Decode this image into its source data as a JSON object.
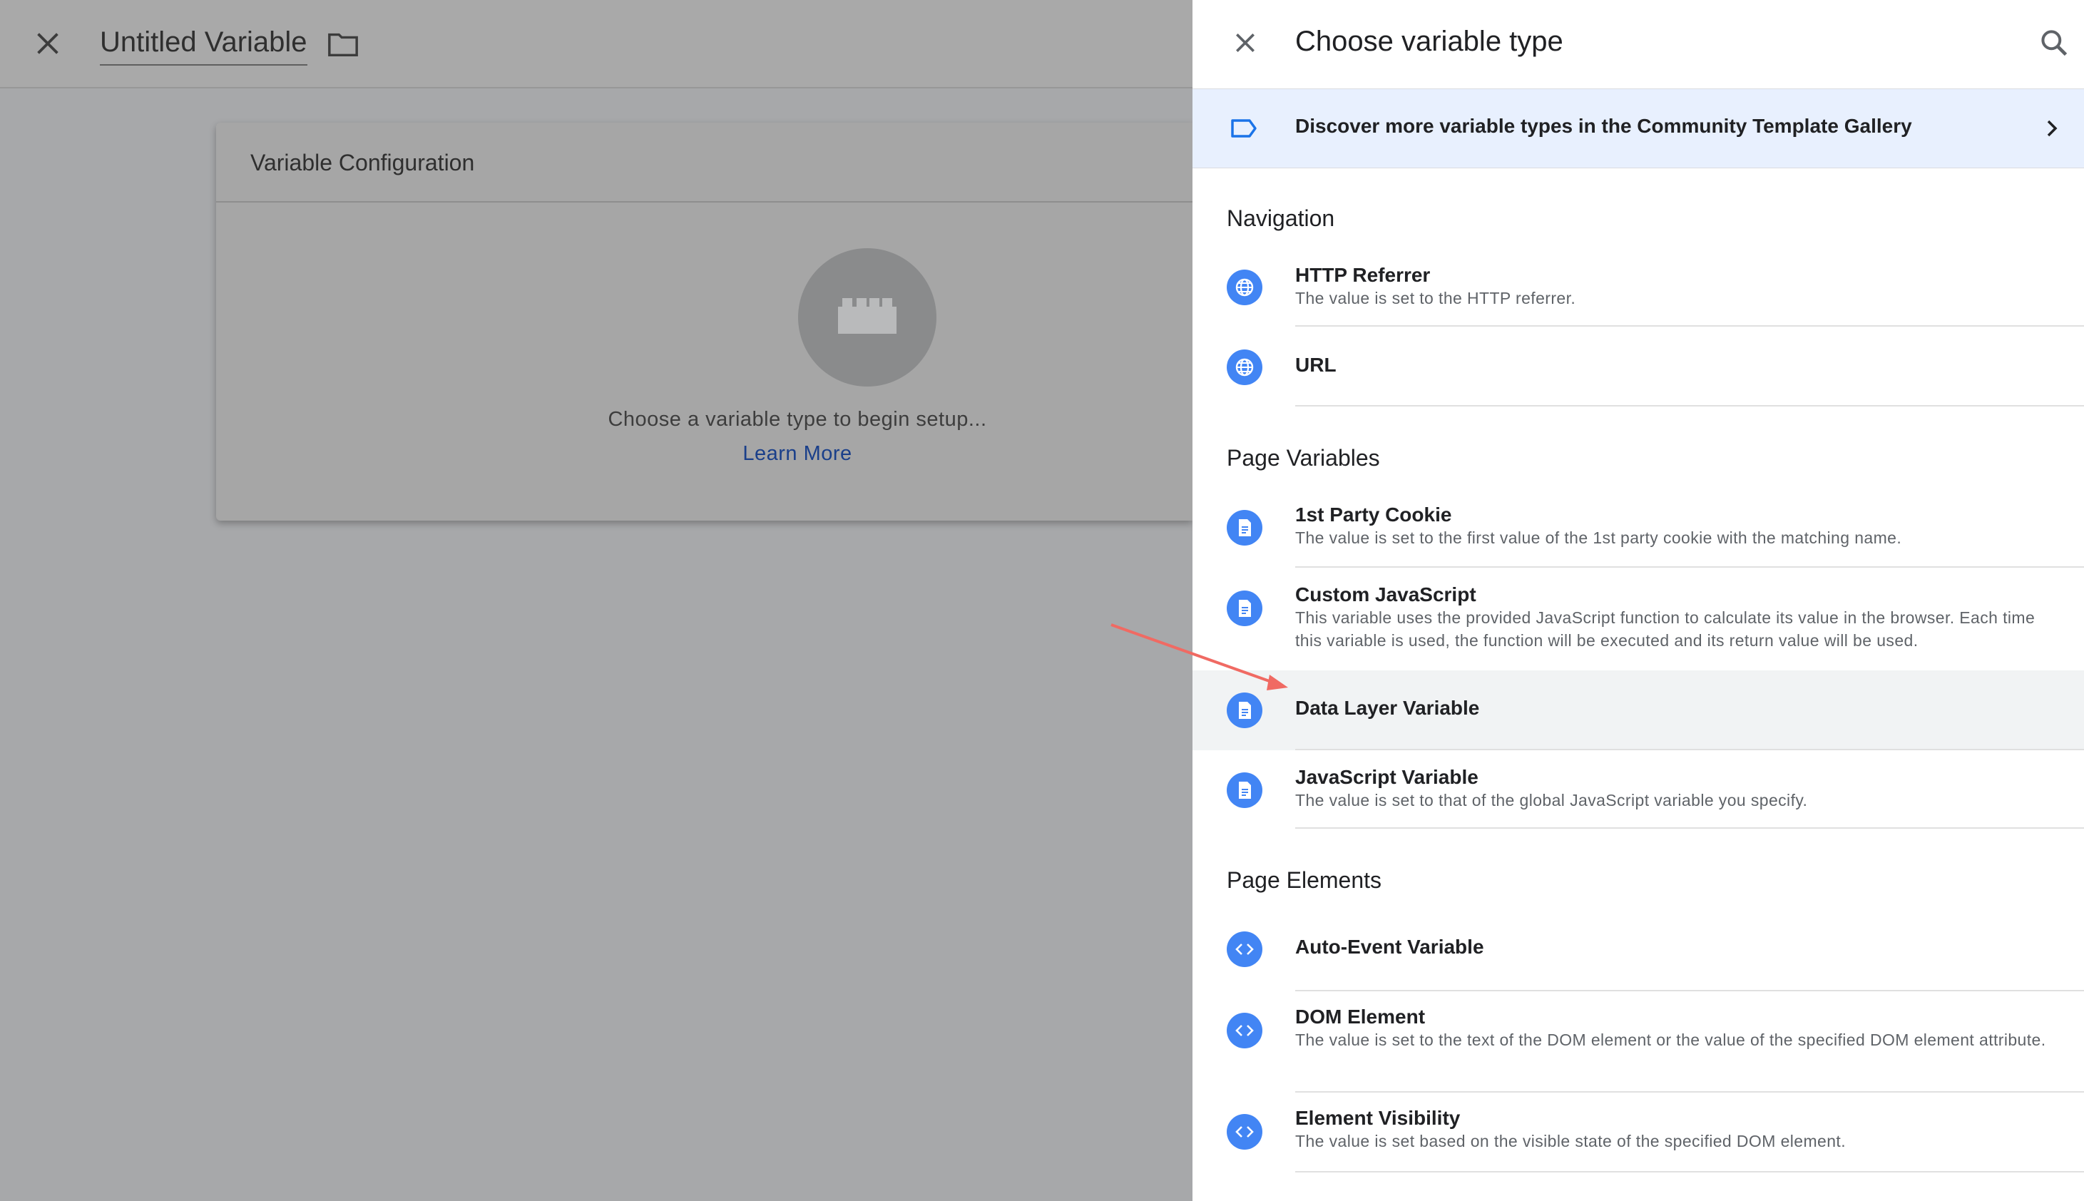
{
  "editor": {
    "title": "Untitled Variable",
    "card_title": "Variable Configuration",
    "prompt": "Choose a variable type to begin setup...",
    "learn_more": "Learn More"
  },
  "panel": {
    "title": "Choose variable type",
    "banner": "Discover more variable types in the Community Template Gallery",
    "sections": {
      "navigation": "Navigation",
      "page_variables": "Page Variables",
      "page_elements": "Page Elements"
    },
    "items": [
      {
        "name": "HTTP Referrer",
        "desc": "The value is set to the HTTP referrer.",
        "icon": "globe-icon"
      },
      {
        "name": "URL",
        "desc": "",
        "icon": "globe-icon"
      },
      {
        "name": "1st Party Cookie",
        "desc": "The value is set to the first value of the 1st party cookie with the matching name.",
        "icon": "document-icon"
      },
      {
        "name": "Custom JavaScript",
        "desc": "This variable uses the provided JavaScript function to calculate its value in the browser. Each time this variable is used, the function will be executed and its return value will be used.",
        "icon": "document-icon"
      },
      {
        "name": "Data Layer Variable",
        "desc": "",
        "icon": "document-icon"
      },
      {
        "name": "JavaScript Variable",
        "desc": "The value is set to that of the global JavaScript variable you specify.",
        "icon": "document-icon"
      },
      {
        "name": "Auto-Event Variable",
        "desc": "",
        "icon": "code-icon"
      },
      {
        "name": "DOM Element",
        "desc": "The value is set to the text of the DOM element or the value of the specified DOM element attribute.",
        "icon": "code-icon"
      },
      {
        "name": "Element Visibility",
        "desc": "The value is set based on the visible state of the specified DOM element.",
        "icon": "code-icon"
      }
    ]
  },
  "colors": {
    "accent": "#4285f4",
    "banner_bg": "#e8f0fe",
    "annotation_arrow": "#f06a63",
    "overlay": "#a7a8aa"
  }
}
